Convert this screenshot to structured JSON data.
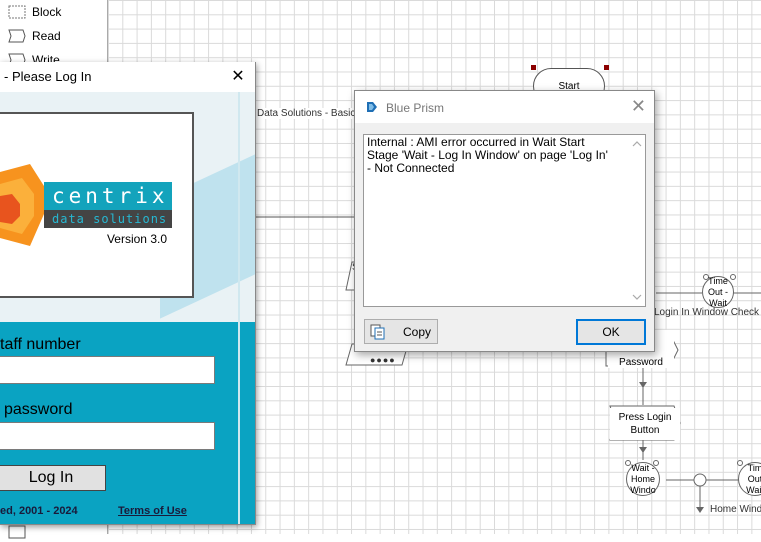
{
  "toolbox": {
    "items": [
      {
        "label": "Block",
        "icon": "block-icon"
      },
      {
        "label": "Read",
        "icon": "read-icon"
      },
      {
        "label": "Write",
        "icon": "write-icon"
      }
    ]
  },
  "canvas": {
    "start_label": "Start",
    "page_note": "Data Solutions - Basic A",
    "stage_partial_s": "S",
    "stage_dots": "●●●●",
    "timeout_wait_1": "Time Out - Wait",
    "login_check_label": "Login In Window Check",
    "staff_password_stage": "aff\nand\nPassword",
    "press_login": "Press Login\nButton",
    "wait_home": "Wait -\nHome\nWindo",
    "timeout_wait_2": "Tim\nOut\nWait",
    "home_window_label": "Home Windo"
  },
  "login_window": {
    "title": "- Please Log In",
    "brand_name": "centrix",
    "brand_sub": "data solutions",
    "version": "Version 3.0",
    "staff_label": "taff number",
    "staff_value": "",
    "password_label": "password",
    "password_value": "",
    "login_button": "Log In",
    "copyright": "ed, 2001 - 2024",
    "terms_link": "Terms of Use"
  },
  "dialog": {
    "title": "Blue Prism",
    "message": "Internal : AMI error occurred in Wait Start\nStage 'Wait - Log In Window' on page 'Log In'\n- Not Connected",
    "copy_button": "Copy",
    "ok_button": "OK"
  },
  "colors": {
    "accent_teal": "#0aa3c2",
    "dialog_focus": "#0078d7",
    "brand_orange": "#f7931e"
  }
}
